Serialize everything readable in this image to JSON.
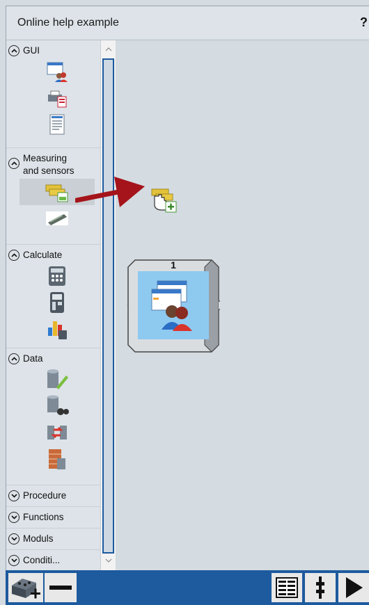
{
  "window": {
    "title": "Online help example",
    "help_label": "?"
  },
  "sidebar": {
    "sections": [
      {
        "label": "GUI",
        "state": "expanded",
        "items": [
          "gui-window-users-icon",
          "printer-icon",
          "document-icon"
        ]
      },
      {
        "label": "Measuring\nand sensors",
        "label_line1": "Measuring",
        "label_line2": "and sensors",
        "state": "expanded",
        "items": [
          "measuring-devices-icon",
          "sensor-device-icon"
        ]
      },
      {
        "label": "Calculate",
        "state": "expanded",
        "items": [
          "calculator-icon",
          "pocket-calculator-icon",
          "chart-calculator-icon"
        ]
      },
      {
        "label": "Data",
        "state": "expanded",
        "items": [
          "database-edit-icon",
          "database-search-icon",
          "database-transfer-icon",
          "database-bricks-icon"
        ]
      },
      {
        "label": "Procedure",
        "state": "collapsed"
      },
      {
        "label": "Functions",
        "state": "collapsed"
      },
      {
        "label": "Moduls",
        "state": "collapsed"
      },
      {
        "label": "Conditi...",
        "state": "collapsed"
      }
    ]
  },
  "canvas": {
    "block": {
      "number": "1",
      "icon": "gui-window-users-icon"
    },
    "drag_cursor": "drag-hand-measuring-icon"
  },
  "toolbar": {
    "add_block": "add-block-icon",
    "remove": "minus-icon",
    "list_view": "list-view-icon",
    "step": "step-icon",
    "run": "play-icon"
  },
  "colors": {
    "accent": "#1d5a9e",
    "arrow": "#a4141a",
    "block_inner": "#8ec9f0",
    "panel": "#dde3e8"
  }
}
